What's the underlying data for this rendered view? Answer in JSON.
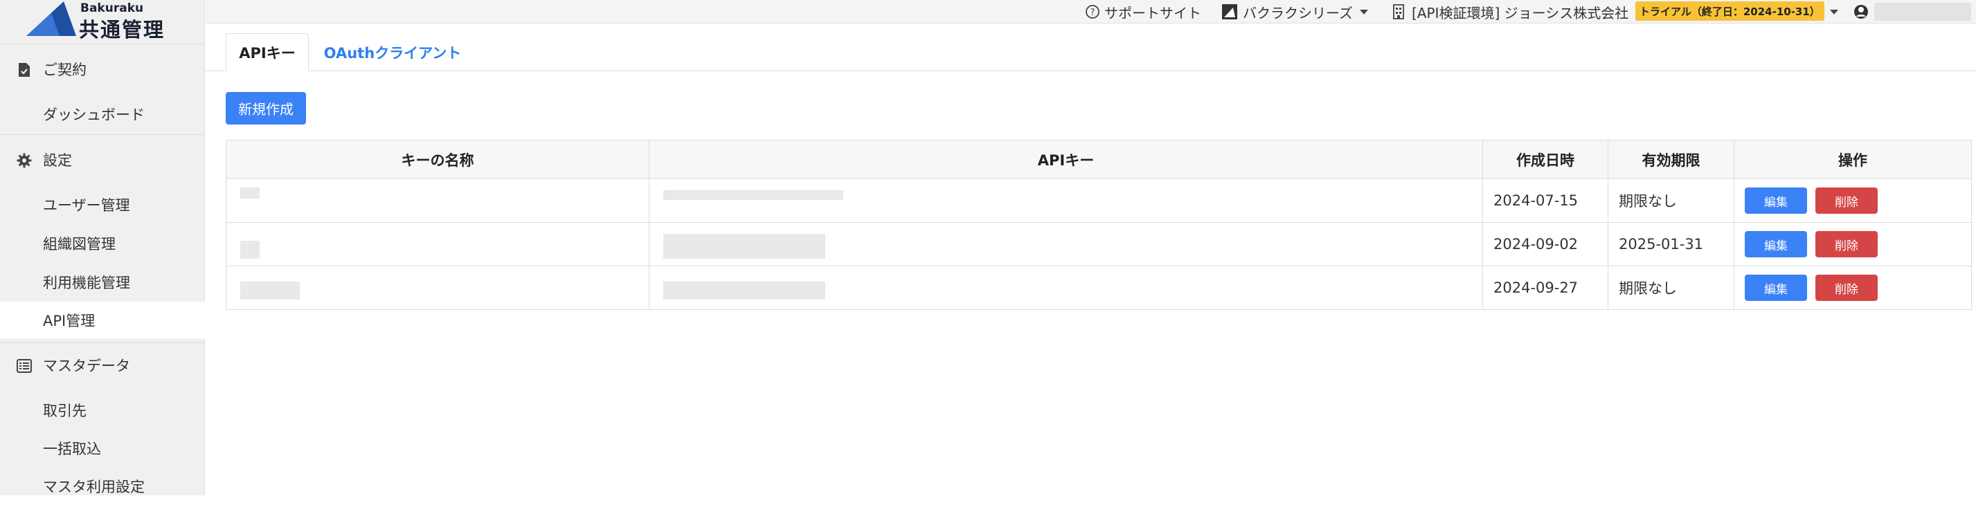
{
  "logo": {
    "sub": "Bakuraku",
    "main": "共通管理"
  },
  "sidebar": {
    "sections": [
      {
        "label": "ご契約",
        "icon": "contract-document-icon"
      },
      {
        "label": "設定",
        "icon": "gear-icon"
      },
      {
        "label": "マスタデータ",
        "icon": "list-icon"
      }
    ],
    "items": [
      {
        "label": "ダッシュボード"
      },
      {
        "label": "ユーザー管理"
      },
      {
        "label": "組織図管理"
      },
      {
        "label": "利用機能管理"
      },
      {
        "label": "API管理",
        "active": true
      },
      {
        "label": "取引先"
      },
      {
        "label": "一括取込"
      },
      {
        "label": "マスタ利用設定"
      }
    ]
  },
  "topbar": {
    "support": "サポートサイト",
    "series": "バクラクシリーズ",
    "company": "[API検証環境] ジョーシス株式会社",
    "trial_badge": "トライアル（終了日：2024-10-31）"
  },
  "tabs": [
    {
      "label": "APIキー",
      "active": true
    },
    {
      "label": "OAuthクライアント",
      "active": false
    }
  ],
  "new_button": "新規作成",
  "table": {
    "headers": [
      "キーの名称",
      "APIキー",
      "作成日時",
      "有効期限",
      "操作"
    ],
    "rows": [
      {
        "created": "2024-07-15",
        "expires": "期限なし",
        "edit": "編集",
        "delete": "削除"
      },
      {
        "created": "2024-09-02",
        "expires": "2025-01-31",
        "edit": "編集",
        "delete": "削除"
      },
      {
        "created": "2024-09-27",
        "expires": "期限なし",
        "edit": "編集",
        "delete": "削除"
      }
    ]
  },
  "colors": {
    "primary": "#3b82f6",
    "danger": "#d64545",
    "trial_badge": "#f7c236",
    "link": "#2f80ed"
  }
}
